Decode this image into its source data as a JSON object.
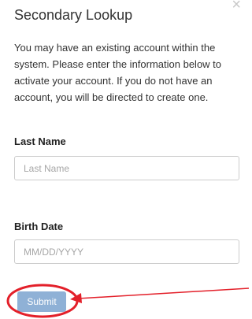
{
  "modal": {
    "title": "Secondary Lookup",
    "close_glyph": "×",
    "description": "You may have an existing account within the system. Please enter the information below to activate your account. If you do not have an account, you will be directed to create one."
  },
  "form": {
    "last_name": {
      "label": "Last Name",
      "value": "",
      "placeholder": "Last Name"
    },
    "birth_date": {
      "label": "Birth Date",
      "value": "",
      "placeholder": "MM/DD/YYYY"
    },
    "submit_label": "Submit"
  },
  "annotation": {
    "color": "#e3202a"
  },
  "colors": {
    "submit_button": "#8fb1d6",
    "input_border": "#cccccc",
    "close_icon": "#c8c8c8"
  }
}
